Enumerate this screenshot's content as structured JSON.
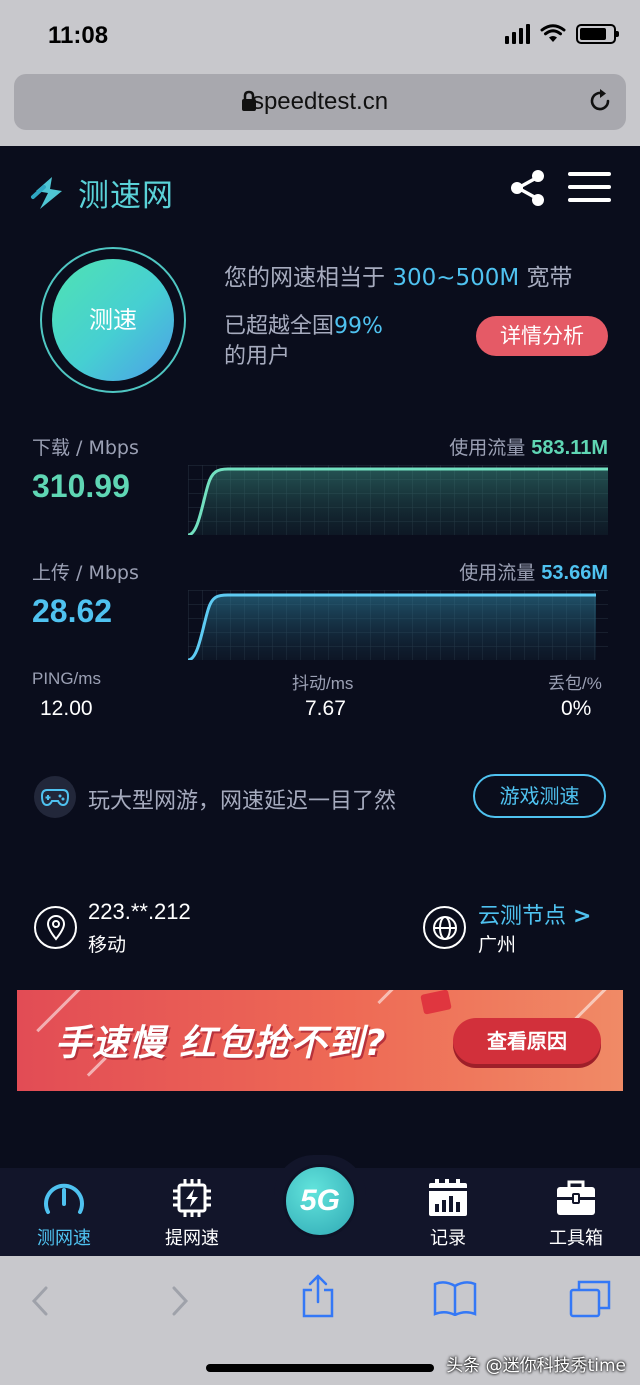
{
  "status": {
    "time": "11:08"
  },
  "browser": {
    "url": "speedtest.cn"
  },
  "header": {
    "logo_text": "测速网"
  },
  "test": {
    "button_label": "测速",
    "compare_prefix": "您的网速相当于",
    "compare_range": "300~500M",
    "compare_suffix": "宽带",
    "beat_prefix": "已超越全国",
    "beat_percent": "99%",
    "beat_suffix": "的用户",
    "detail_button": "详情分析"
  },
  "download": {
    "label": "下载 / Mbps",
    "value": "310.99",
    "usage_label": "使用流量",
    "usage_value": "583.11M",
    "color": "#5fd6b4"
  },
  "upload": {
    "label": "上传 / Mbps",
    "value": "28.62",
    "usage_label": "使用流量",
    "usage_value": "53.66M",
    "color": "#4fc2f0"
  },
  "stats": {
    "ping_label": "PING/ms",
    "ping_value": "12.00",
    "jitter_label": "抖动/ms",
    "jitter_value": "7.67",
    "loss_label": "丢包/%",
    "loss_value": "0%"
  },
  "game": {
    "text": "玩大型网游，网速延迟一目了然",
    "button": "游戏测速"
  },
  "network": {
    "ip": "223.**.212",
    "isp": "移动",
    "node_label": "云测节点",
    "node_arrow": ">",
    "node_city": "广州"
  },
  "banner": {
    "text": "手速慢 红包抢不到?",
    "button": "查看原因"
  },
  "nav": {
    "items": [
      {
        "label": "测网速",
        "icon": "speedometer-icon"
      },
      {
        "label": "提网速",
        "icon": "chip-icon"
      },
      {
        "label": "5G",
        "icon": "5g-icon"
      },
      {
        "label": "记录",
        "icon": "calendar-chart-icon"
      },
      {
        "label": "工具箱",
        "icon": "toolbox-icon"
      }
    ]
  },
  "watermark": {
    "text": "头条 @迷你科技秀time"
  },
  "colors": {
    "accent": "#4fc2f0",
    "teal": "#5fd6b4",
    "background": "#0a0d1c",
    "danger": "#e55a66"
  }
}
